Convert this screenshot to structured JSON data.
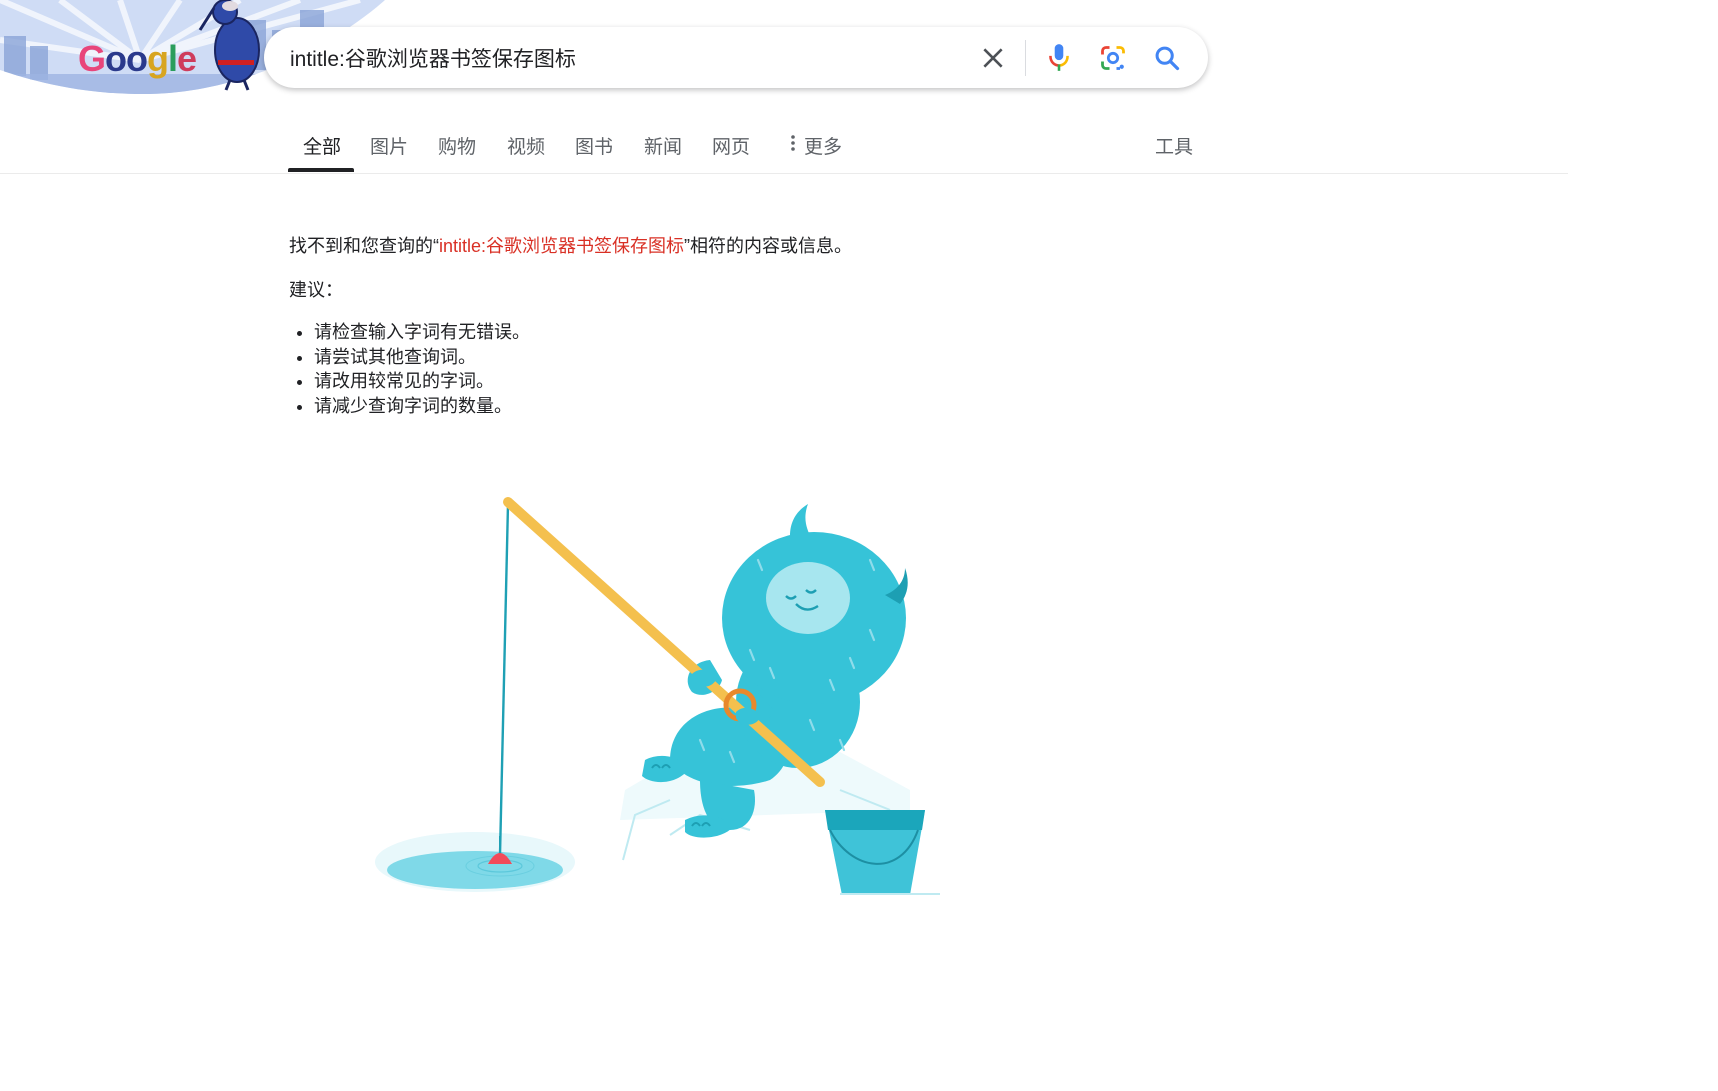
{
  "doodle": {
    "logo_letters": [
      "G",
      "o",
      "o",
      "g",
      "l",
      "e"
    ]
  },
  "search": {
    "query": "intitle:谷歌浏览器书签保存图标",
    "clear_icon": "close-icon",
    "voice_icon": "microphone-icon",
    "lens_icon": "camera-lens-icon",
    "search_icon": "search-icon"
  },
  "tabs": [
    {
      "label": "全部",
      "active": true
    },
    {
      "label": "图片",
      "active": false
    },
    {
      "label": "购物",
      "active": false
    },
    {
      "label": "视频",
      "active": false
    },
    {
      "label": "图书",
      "active": false
    },
    {
      "label": "新闻",
      "active": false
    },
    {
      "label": "网页",
      "active": false
    },
    {
      "label": "更多",
      "active": false
    }
  ],
  "tools_label": "工具",
  "message": {
    "prefix": "找不到和您查询的“",
    "query": "intitle:谷歌浏览器书签保存图标",
    "suffix": "”相符的内容或信息。"
  },
  "suggestions": {
    "title": "建议：",
    "items": [
      "请检查输入字词有无错误。",
      "请尝试其他查询词。",
      "请改用较常见的字词。",
      "请减少查询字词的数量。"
    ]
  },
  "colors": {
    "query_highlight": "#d93025",
    "monster": "#36c3d8",
    "rod": "#f4c04e"
  }
}
